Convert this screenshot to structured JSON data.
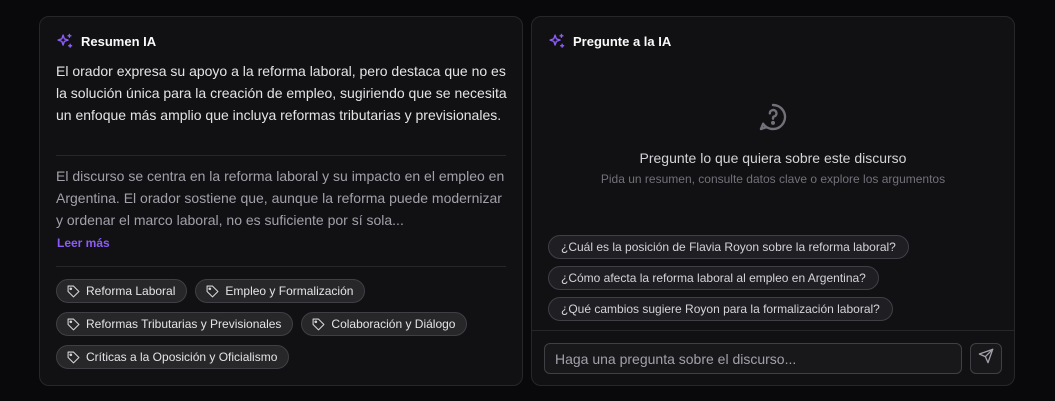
{
  "summary_panel": {
    "title": "Resumen IA",
    "lead": "El orador expresa su apoyo a la reforma laboral, pero destaca que no es la solución única para la creación de empleo, sugiriendo que se necesita un enfoque más amplio que incluya reformas tributarias y previsionales.",
    "body": "El discurso se centra en la reforma laboral y su impacto en el empleo en Argentina. El orador sostiene que, aunque la reforma puede modernizar y ordenar el marco laboral, no es suficiente por sí sola...",
    "read_more": "Leer más",
    "tags": [
      "Reforma Laboral",
      "Empleo y Formalización",
      "Reformas Tributarias y Previsionales",
      "Colaboración y Diálogo",
      "Críticas a la Oposición y Oficialismo"
    ]
  },
  "ask_panel": {
    "title": "Pregunte a la IA",
    "empty_title": "Pregunte lo que quiera sobre este discurso",
    "empty_subtitle": "Pida un resumen, consulte datos clave o explore los argumentos",
    "suggestions": [
      "¿Cuál es la posición de Flavia Royon sobre la reforma laboral?",
      "¿Cómo afecta la reforma laboral al empleo en Argentina?",
      "¿Qué cambios sugiere Royon para la formalización laboral?"
    ],
    "input_placeholder": "Haga una pregunta sobre el discurso..."
  },
  "colors": {
    "background": "#09090b",
    "card": "#111113",
    "accent": "#8b5cf6",
    "border": "#27272a"
  },
  "icons": [
    "sparkles-icon",
    "tag-icon",
    "help-circle-icon",
    "send-icon"
  ]
}
